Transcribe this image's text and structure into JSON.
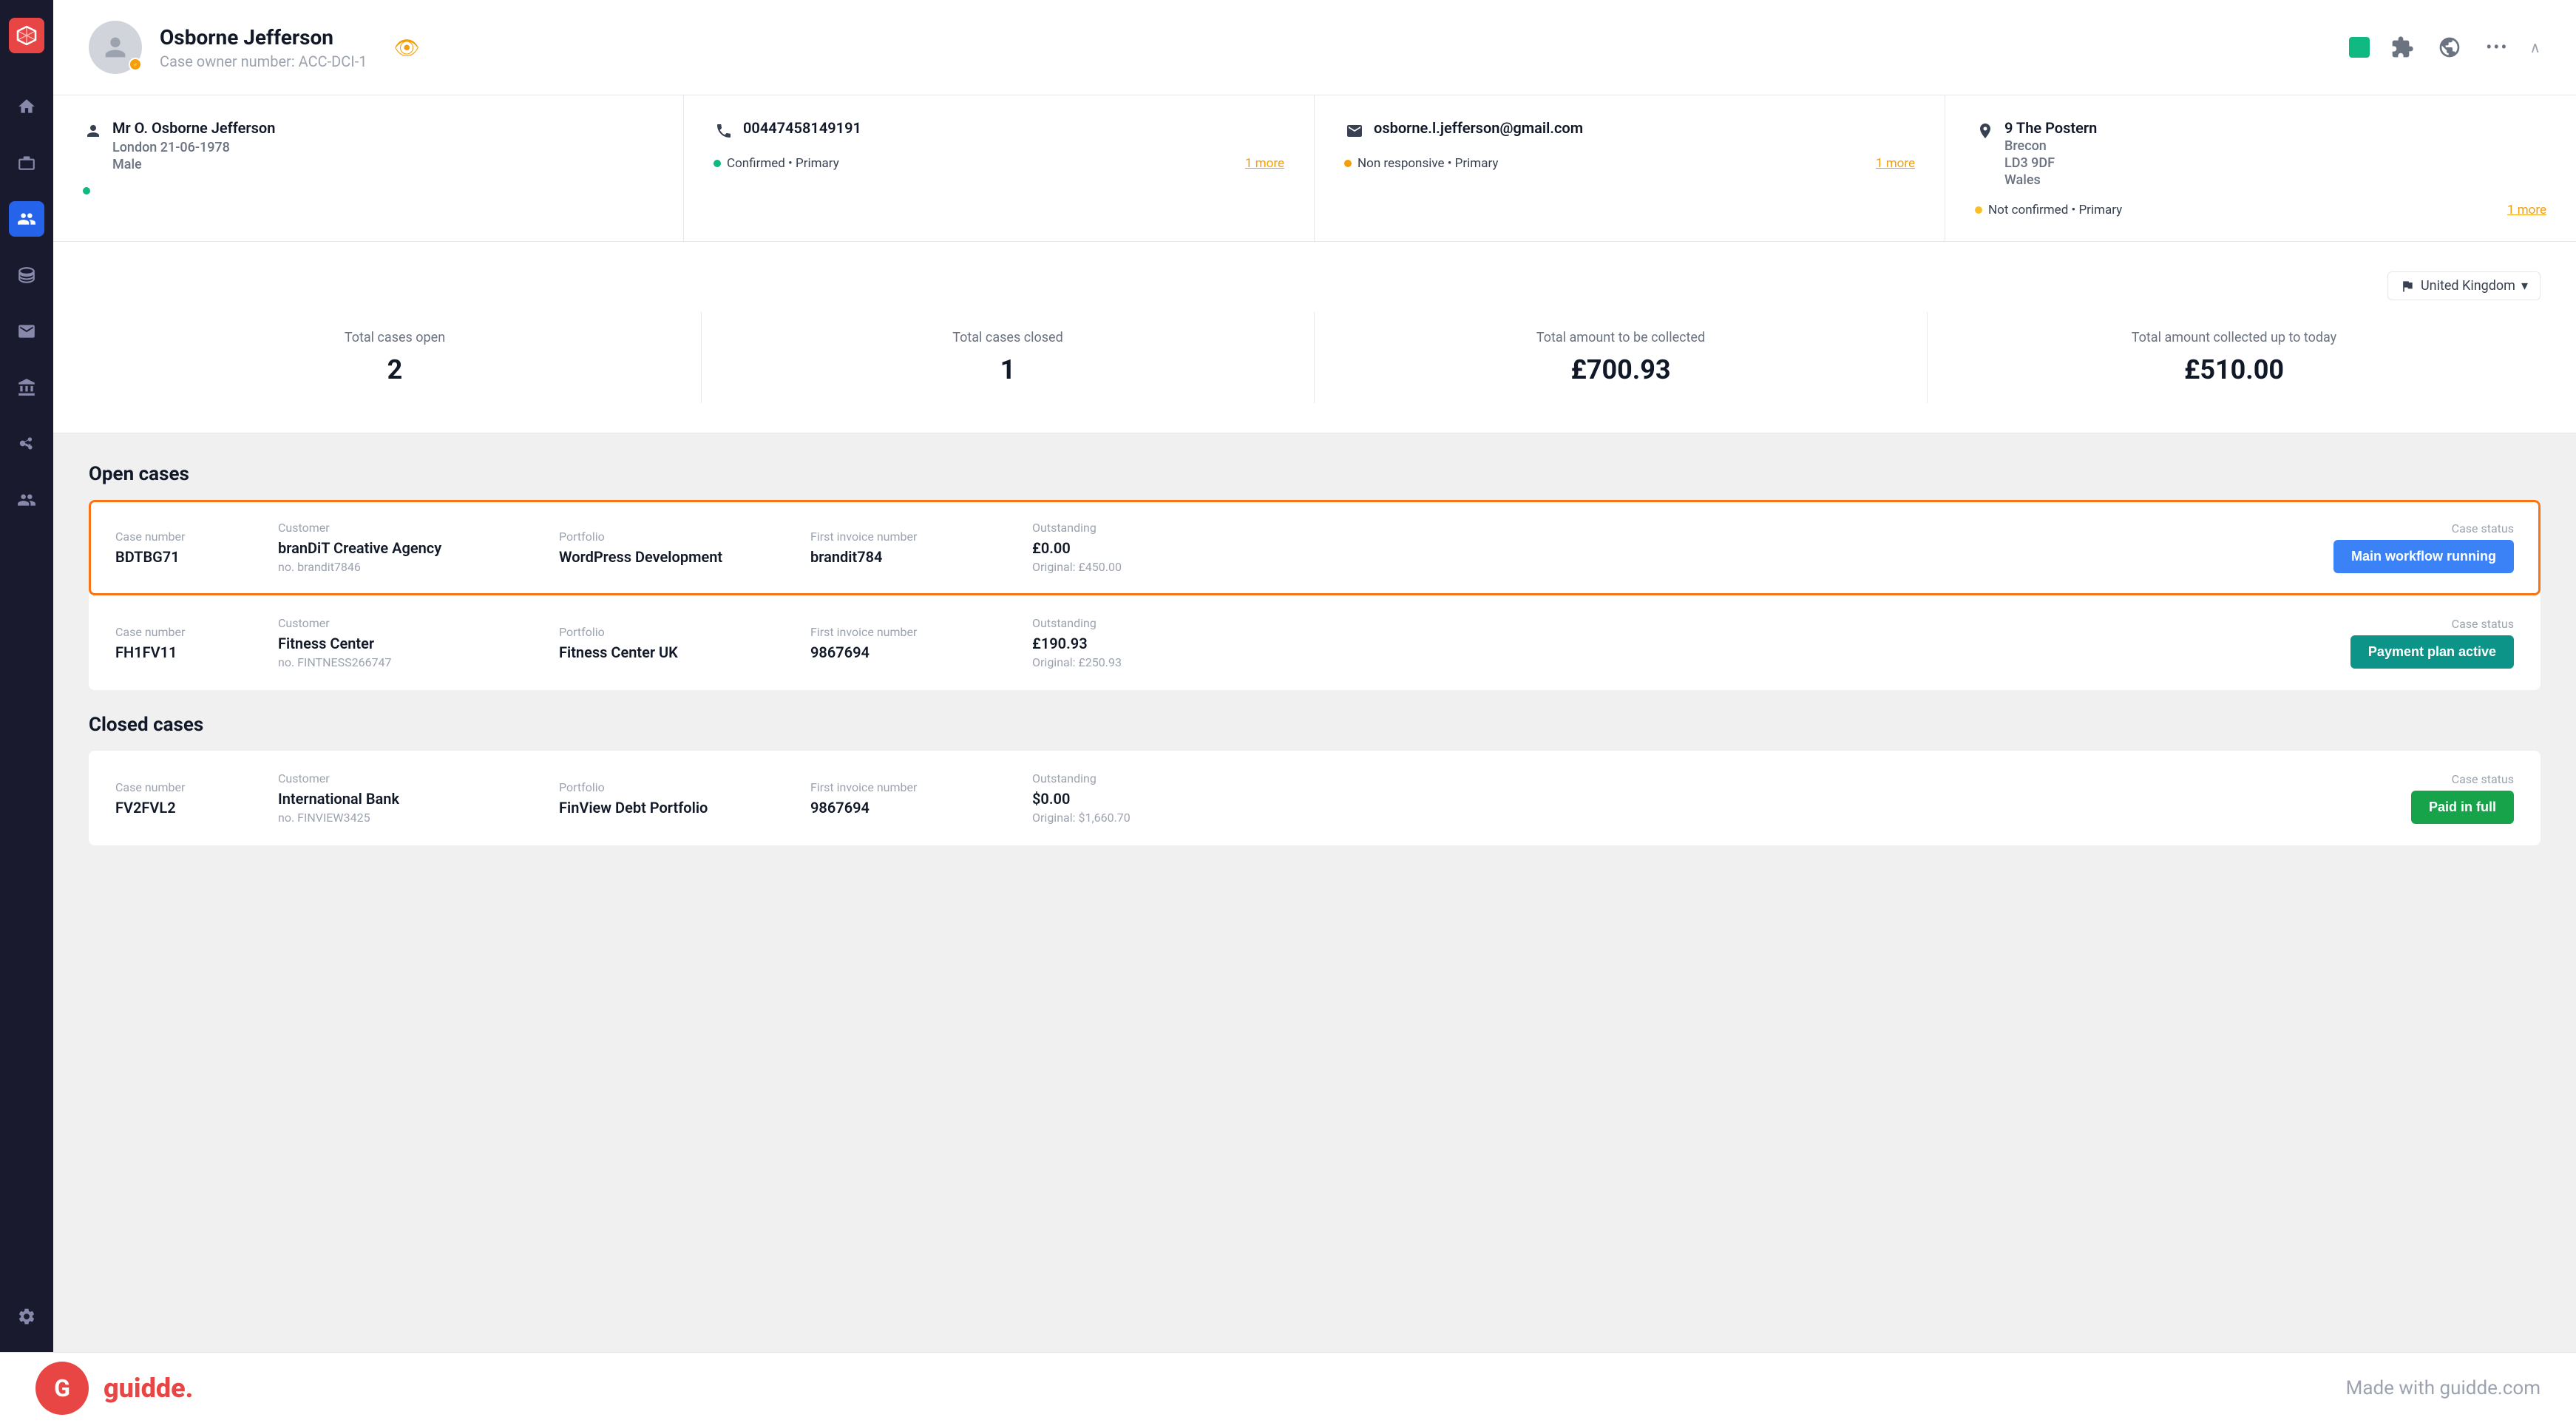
{
  "sidebar": {
    "logo_text": "◇",
    "items": [
      {
        "name": "home",
        "icon": "home",
        "active": false
      },
      {
        "name": "cases",
        "icon": "briefcase",
        "active": false
      },
      {
        "name": "contacts",
        "icon": "users",
        "active": true
      },
      {
        "name": "data",
        "icon": "database",
        "active": false
      },
      {
        "name": "mail",
        "icon": "mail",
        "active": false
      },
      {
        "name": "bank",
        "icon": "bank",
        "active": false
      },
      {
        "name": "git",
        "icon": "git",
        "active": false
      },
      {
        "name": "team",
        "icon": "team",
        "active": false
      }
    ],
    "bottom_items": [
      {
        "name": "settings",
        "icon": "gear"
      }
    ]
  },
  "header": {
    "avatar_letter": "♂",
    "name": "Osborne Jefferson",
    "case_owner_label": "Case owner number: ACC-DCI-1",
    "icons": {
      "green_square": "green",
      "puzzle": "🧩",
      "globe": "🌐",
      "more": "...",
      "chevron": "∧"
    }
  },
  "info_cards": [
    {
      "icon": "person",
      "name": "Mr O. Osborne Jefferson",
      "line2": "London 21-06-1978",
      "line3": "Male",
      "status_dot": "green",
      "status_text": "",
      "more_text": ""
    },
    {
      "icon": "phone",
      "value": "00447458149191",
      "status_dot": "green",
      "status_text": "Confirmed • Primary",
      "more_text": "1 more",
      "more_color": "orange"
    },
    {
      "icon": "email",
      "value": "osborne.l.jefferson@gmail.com",
      "status_dot": "orange",
      "status_text": "Non responsive • Primary",
      "more_text": "1 more",
      "more_color": "orange"
    },
    {
      "icon": "location",
      "line1": "9 The Postern",
      "line2": "Brecon",
      "line3": "LD3 9DF",
      "line4": "Wales",
      "status_dot": "yellow",
      "status_text": "Not confirmed • Primary",
      "more_text": "1 more",
      "more_color": "orange"
    }
  ],
  "stats": {
    "country": "United Kingdom",
    "items": [
      {
        "label": "Total cases open",
        "value": "2"
      },
      {
        "label": "Total cases closed",
        "value": "1"
      },
      {
        "label": "Total amount to be collected",
        "value": "£700.93"
      },
      {
        "label": "Total amount collected up to today",
        "value": "£510.00"
      }
    ]
  },
  "open_cases": {
    "title": "Open cases",
    "rows": [
      {
        "case_number_label": "Case number",
        "case_number": "BDTBG71",
        "customer_label": "Customer",
        "customer": "branDiT Creative Agency",
        "customer_no": "no. brandit7846",
        "portfolio_label": "Portfolio",
        "portfolio": "WordPress Development",
        "invoice_label": "First invoice number",
        "invoice": "brandit784",
        "outstanding_label": "Outstanding",
        "outstanding": "£0.00",
        "original": "Original: £450.00",
        "status_label": "Case status",
        "status": "Main workflow running",
        "status_class": "blue",
        "highlighted": true
      },
      {
        "case_number_label": "Case number",
        "case_number": "FH1FV11",
        "customer_label": "Customer",
        "customer": "Fitness Center",
        "customer_no": "no. FINTNESS266747",
        "portfolio_label": "Portfolio",
        "portfolio": "Fitness Center UK",
        "invoice_label": "First invoice number",
        "invoice": "9867694",
        "outstanding_label": "Outstanding",
        "outstanding": "£190.93",
        "original": "Original: £250.93",
        "status_label": "Case status",
        "status": "Payment plan active",
        "status_class": "teal",
        "highlighted": false
      }
    ]
  },
  "closed_cases": {
    "title": "Closed cases",
    "rows": [
      {
        "case_number_label": "Case number",
        "case_number": "FV2FVL2",
        "customer_label": "Customer",
        "customer": "International Bank",
        "customer_no": "no. FINVIEW3425",
        "portfolio_label": "Portfolio",
        "portfolio": "FinView Debt Portfolio",
        "invoice_label": "First invoice number",
        "invoice": "9867694",
        "outstanding_label": "Outstanding",
        "outstanding": "$0.00",
        "original": "Original: $1,660.70",
        "status_label": "Case status",
        "status": "Paid in full",
        "status_class": "green-btn"
      }
    ]
  },
  "footer": {
    "logo": "guidde.",
    "tagline": "Made with guidde.com"
  }
}
